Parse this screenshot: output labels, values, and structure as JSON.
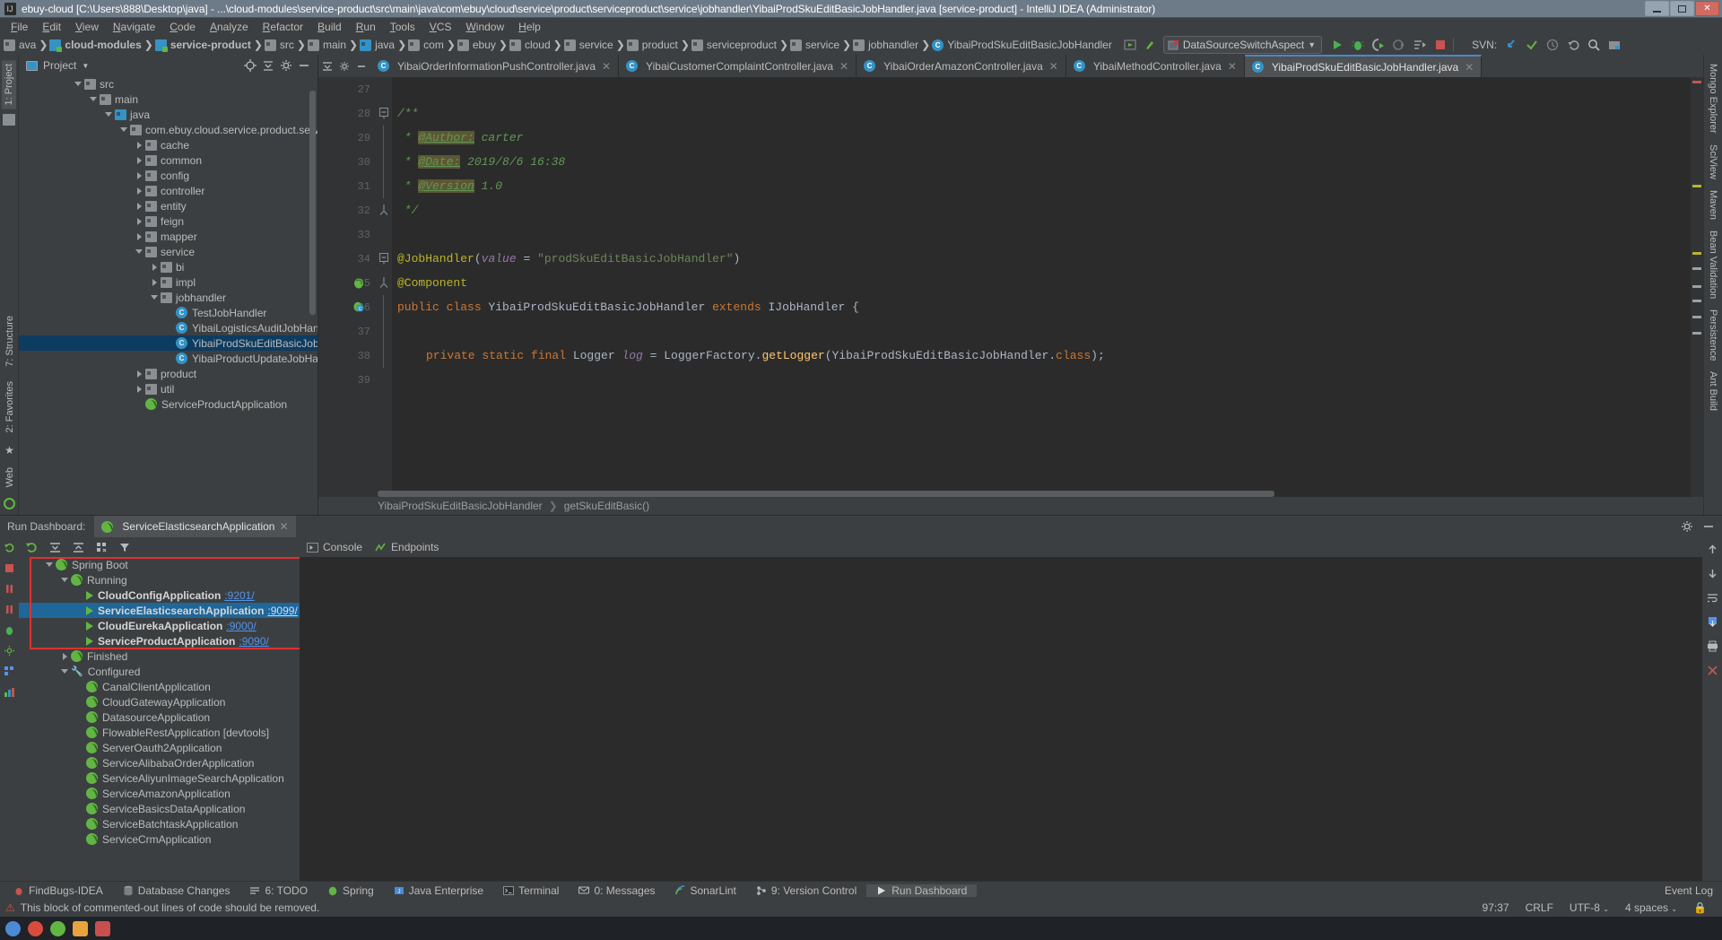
{
  "window": {
    "title": "ebuy-cloud [C:\\Users\\888\\Desktop\\java] - ...\\cloud-modules\\service-product\\src\\main\\java\\com\\ebuy\\cloud\\service\\product\\serviceproduct\\service\\jobhandler\\YibaiProdSkuEditBasicJobHandler.java [service-product] - IntelliJ IDEA (Administrator)",
    "minimize_label": "Minimize",
    "maximize_label": "Restore",
    "close_label": "Close"
  },
  "menubar": [
    "File",
    "Edit",
    "View",
    "Navigate",
    "Code",
    "Analyze",
    "Refactor",
    "Build",
    "Run",
    "Tools",
    "VCS",
    "Window",
    "Help"
  ],
  "navbar": {
    "crumbs": [
      {
        "label": "ava",
        "icon": "folder-icon",
        "bold": false
      },
      {
        "label": "cloud-modules",
        "icon": "module-icon",
        "bold": true
      },
      {
        "label": "service-product",
        "icon": "module-icon",
        "bold": true
      },
      {
        "label": "src",
        "icon": "folder-icon",
        "bold": false
      },
      {
        "label": "main",
        "icon": "folder-icon",
        "bold": false
      },
      {
        "label": "java",
        "icon": "folder-blue-icon",
        "bold": false
      },
      {
        "label": "com",
        "icon": "package-icon",
        "bold": false
      },
      {
        "label": "ebuy",
        "icon": "package-icon",
        "bold": false
      },
      {
        "label": "cloud",
        "icon": "package-icon",
        "bold": false
      },
      {
        "label": "service",
        "icon": "package-icon",
        "bold": false
      },
      {
        "label": "product",
        "icon": "package-icon",
        "bold": false
      },
      {
        "label": "serviceproduct",
        "icon": "package-icon",
        "bold": false
      },
      {
        "label": "service",
        "icon": "package-icon",
        "bold": false
      },
      {
        "label": "jobhandler",
        "icon": "package-icon",
        "bold": false
      },
      {
        "label": "YibaiProdSkuEditBasicJobHandler",
        "icon": "class-icon",
        "bold": false
      }
    ],
    "run_config": "DataSourceSwitchAspect",
    "svn_label": "SVN:"
  },
  "project_panel": {
    "title": "Project",
    "rail_tab": "1: Project",
    "tree": [
      {
        "label": "src",
        "depth": 3,
        "expand": "down",
        "icon": "folder-icon"
      },
      {
        "label": "main",
        "depth": 4,
        "expand": "down",
        "icon": "folder-icon"
      },
      {
        "label": "java",
        "depth": 5,
        "expand": "down",
        "icon": "folder-blue-icon"
      },
      {
        "label": "com.ebuy.cloud.service.product.serviceprodu",
        "depth": 6,
        "expand": "down",
        "icon": "package-icon"
      },
      {
        "label": "cache",
        "depth": 7,
        "expand": "right",
        "icon": "package-icon"
      },
      {
        "label": "common",
        "depth": 7,
        "expand": "right",
        "icon": "package-icon"
      },
      {
        "label": "config",
        "depth": 7,
        "expand": "right",
        "icon": "package-icon"
      },
      {
        "label": "controller",
        "depth": 7,
        "expand": "right",
        "icon": "package-icon"
      },
      {
        "label": "entity",
        "depth": 7,
        "expand": "right",
        "icon": "package-icon"
      },
      {
        "label": "feign",
        "depth": 7,
        "expand": "right",
        "icon": "package-icon"
      },
      {
        "label": "mapper",
        "depth": 7,
        "expand": "right",
        "icon": "package-icon"
      },
      {
        "label": "service",
        "depth": 7,
        "expand": "down",
        "icon": "package-icon"
      },
      {
        "label": "bi",
        "depth": 8,
        "expand": "right",
        "icon": "package-icon"
      },
      {
        "label": "impl",
        "depth": 8,
        "expand": "right",
        "icon": "package-icon"
      },
      {
        "label": "jobhandler",
        "depth": 8,
        "expand": "down",
        "icon": "package-icon"
      },
      {
        "label": "TestJobHandler",
        "depth": 9,
        "expand": "none",
        "icon": "class-icon"
      },
      {
        "label": "YibaiLogisticsAuditJobHandler",
        "depth": 9,
        "expand": "none",
        "icon": "class-icon"
      },
      {
        "label": "YibaiProdSkuEditBasicJobHandler",
        "depth": 9,
        "expand": "none",
        "icon": "class-icon",
        "selected": true
      },
      {
        "label": "YibaiProductUpdateJobHandler",
        "depth": 9,
        "expand": "none",
        "icon": "class-icon"
      },
      {
        "label": "product",
        "depth": 7,
        "expand": "right",
        "icon": "package-icon"
      },
      {
        "label": "util",
        "depth": 7,
        "expand": "right",
        "icon": "package-icon"
      },
      {
        "label": "ServiceProductApplication",
        "depth": 7,
        "expand": "none",
        "icon": "spring-icon"
      }
    ]
  },
  "editor": {
    "tabs": [
      {
        "label": "YibaiOrderInformationPushController.java",
        "active": false
      },
      {
        "label": "YibaiCustomerComplaintController.java",
        "active": false
      },
      {
        "label": "YibaiOrderAmazonController.java",
        "active": false
      },
      {
        "label": "YibaiMethodController.java",
        "active": false
      },
      {
        "label": "YibaiProdSkuEditBasicJobHandler.java",
        "active": true
      }
    ],
    "lines": [
      {
        "n": "27",
        "segs": []
      },
      {
        "n": "28",
        "fold": "start",
        "segs": [
          {
            "t": "/**",
            "c": "c-cmt"
          }
        ]
      },
      {
        "n": "29",
        "segs": [
          {
            "t": " * ",
            "c": "c-cmt"
          },
          {
            "t": "@Author:",
            "c": "c-tag"
          },
          {
            "t": " carter",
            "c": "c-tagtxt"
          }
        ]
      },
      {
        "n": "30",
        "segs": [
          {
            "t": " * ",
            "c": "c-cmt"
          },
          {
            "t": "@Date:",
            "c": "c-tag"
          },
          {
            "t": " 2019/8/6 16:38",
            "c": "c-tagtxt"
          }
        ]
      },
      {
        "n": "31",
        "segs": [
          {
            "t": " * ",
            "c": "c-cmt"
          },
          {
            "t": "@Version",
            "c": "c-tag"
          },
          {
            "t": " 1.0",
            "c": "c-tagtxt"
          }
        ]
      },
      {
        "n": "32",
        "fold": "end",
        "segs": [
          {
            "t": " */",
            "c": "c-cmt"
          }
        ]
      },
      {
        "n": "33",
        "segs": []
      },
      {
        "n": "34",
        "fold": "start",
        "segs": [
          {
            "t": "@JobHandler",
            "c": "c-ann"
          },
          {
            "t": "(",
            "c": "c-pln"
          },
          {
            "t": "value",
            "c": "c-fld"
          },
          {
            "t": " = ",
            "c": "c-pln"
          },
          {
            "t": "\"prodSkuEditBasicJobHandler\"",
            "c": "c-str"
          },
          {
            "t": ")",
            "c": "c-pln"
          }
        ]
      },
      {
        "n": "35",
        "gut": "spring",
        "fold": "end",
        "segs": [
          {
            "t": "@Component",
            "c": "c-ann"
          }
        ]
      },
      {
        "n": "36",
        "gut": "class",
        "segs": [
          {
            "t": "public class ",
            "c": "c-kw"
          },
          {
            "t": "YibaiProdSkuEditBasicJobHandler",
            "c": "c-pln"
          },
          {
            "t": " extends ",
            "c": "c-kw"
          },
          {
            "t": "IJobHandler",
            "c": "c-pln"
          },
          {
            "t": " {",
            "c": "c-pln"
          }
        ]
      },
      {
        "n": "37",
        "segs": []
      },
      {
        "n": "38",
        "indent": 4,
        "segs": [
          {
            "t": "private static final ",
            "c": "c-kw"
          },
          {
            "t": "Logger ",
            "c": "c-pln"
          },
          {
            "t": "log",
            "c": "c-fld"
          },
          {
            "t": " = LoggerFactory.",
            "c": "c-pln"
          },
          {
            "t": "getLogger",
            "c": "c-mth"
          },
          {
            "t": "(YibaiProdSkuEditBasicJobHandler.",
            "c": "c-pln"
          },
          {
            "t": "class",
            "c": "c-kw"
          },
          {
            "t": ");",
            "c": "c-pln"
          }
        ]
      },
      {
        "n": "39",
        "segs": []
      }
    ],
    "breadcrumb_bottom": [
      "YibaiProdSkuEditBasicJobHandler",
      "getSkuEditBasic()"
    ]
  },
  "right_rail": [
    "Mongo Explorer",
    "SciView",
    "Maven",
    "Bean Validation",
    "Persistence",
    "Ant Build"
  ],
  "run_dashboard": {
    "title": "Run Dashboard:",
    "tab_label": "ServiceElasticsearchApplication",
    "console_tabs": [
      {
        "label": "Console",
        "icon": "console-icon"
      },
      {
        "label": "Endpoints",
        "icon": "endpoints-icon"
      }
    ],
    "tree": [
      {
        "label": "Spring Boot",
        "depth": 1,
        "expand": "down",
        "icon": "spring-icon",
        "bold": false
      },
      {
        "label": "Running",
        "depth": 2,
        "expand": "down",
        "icon": "spring-icon",
        "bold": false
      },
      {
        "label": "CloudConfigApplication",
        "depth": 3,
        "expand": "none",
        "icon": "run-icon",
        "port": ":9201/",
        "bold": true
      },
      {
        "label": "ServiceElasticsearchApplication",
        "depth": 3,
        "expand": "none",
        "icon": "run-icon",
        "port": ":9099/",
        "bold": true,
        "selected": true
      },
      {
        "label": "CloudEurekaApplication",
        "depth": 3,
        "expand": "none",
        "icon": "run-icon",
        "port": ":9000/",
        "bold": true
      },
      {
        "label": "ServiceProductApplication",
        "depth": 3,
        "expand": "none",
        "icon": "run-icon",
        "port": ":9090/",
        "bold": true
      },
      {
        "label": "Finished",
        "depth": 2,
        "expand": "right",
        "icon": "spring-icon",
        "bold": false
      },
      {
        "label": "Configured",
        "depth": 2,
        "expand": "down",
        "icon": "wrench-icon",
        "bold": false
      },
      {
        "label": "CanalClientApplication",
        "depth": 3,
        "expand": "none",
        "icon": "spring-icon",
        "bold": false
      },
      {
        "label": "CloudGatewayApplication",
        "depth": 3,
        "expand": "none",
        "icon": "spring-icon",
        "bold": false
      },
      {
        "label": "DatasourceApplication",
        "depth": 3,
        "expand": "none",
        "icon": "spring-icon",
        "bold": false
      },
      {
        "label": "FlowableRestApplication [devtools]",
        "depth": 3,
        "expand": "none",
        "icon": "spring-icon",
        "bold": false
      },
      {
        "label": "ServerOauth2Application",
        "depth": 3,
        "expand": "none",
        "icon": "spring-icon",
        "bold": false
      },
      {
        "label": "ServiceAlibabaOrderApplication",
        "depth": 3,
        "expand": "none",
        "icon": "spring-icon",
        "bold": false
      },
      {
        "label": "ServiceAliyunImageSearchApplication",
        "depth": 3,
        "expand": "none",
        "icon": "spring-icon",
        "bold": false
      },
      {
        "label": "ServiceAmazonApplication",
        "depth": 3,
        "expand": "none",
        "icon": "spring-icon",
        "bold": false
      },
      {
        "label": "ServiceBasicsDataApplication",
        "depth": 3,
        "expand": "none",
        "icon": "spring-icon",
        "bold": false
      },
      {
        "label": "ServiceBatchtaskApplication",
        "depth": 3,
        "expand": "none",
        "icon": "spring-icon",
        "bold": false
      },
      {
        "label": "ServiceCrmApplication",
        "depth": 3,
        "expand": "none",
        "icon": "spring-icon",
        "bold": false
      }
    ]
  },
  "toolstrip": {
    "items": [
      {
        "label": "FindBugs-IDEA",
        "icon": "bug-icon",
        "active": false
      },
      {
        "label": "Database Changes",
        "icon": "database-icon",
        "active": false
      },
      {
        "label": "6: TODO",
        "icon": "todo-icon",
        "active": false
      },
      {
        "label": "Spring",
        "icon": "spring-icon",
        "active": false
      },
      {
        "label": "Java Enterprise",
        "icon": "java-icon",
        "active": false
      },
      {
        "label": "Terminal",
        "icon": "terminal-icon",
        "active": false
      },
      {
        "label": "0: Messages",
        "icon": "messages-icon",
        "active": false
      },
      {
        "label": "SonarLint",
        "icon": "sonarlint-icon",
        "active": false
      },
      {
        "label": "9: Version Control",
        "icon": "vcs-icon",
        "active": false
      },
      {
        "label": "Run Dashboard",
        "icon": "run-icon",
        "active": true
      }
    ],
    "event_log": "Event Log"
  },
  "statusbar": {
    "message": "This block of commented-out lines of code should be removed.",
    "position": "97:37",
    "line_separator": "CRLF",
    "encoding": "UTF-8",
    "indent": "4 spaces"
  }
}
